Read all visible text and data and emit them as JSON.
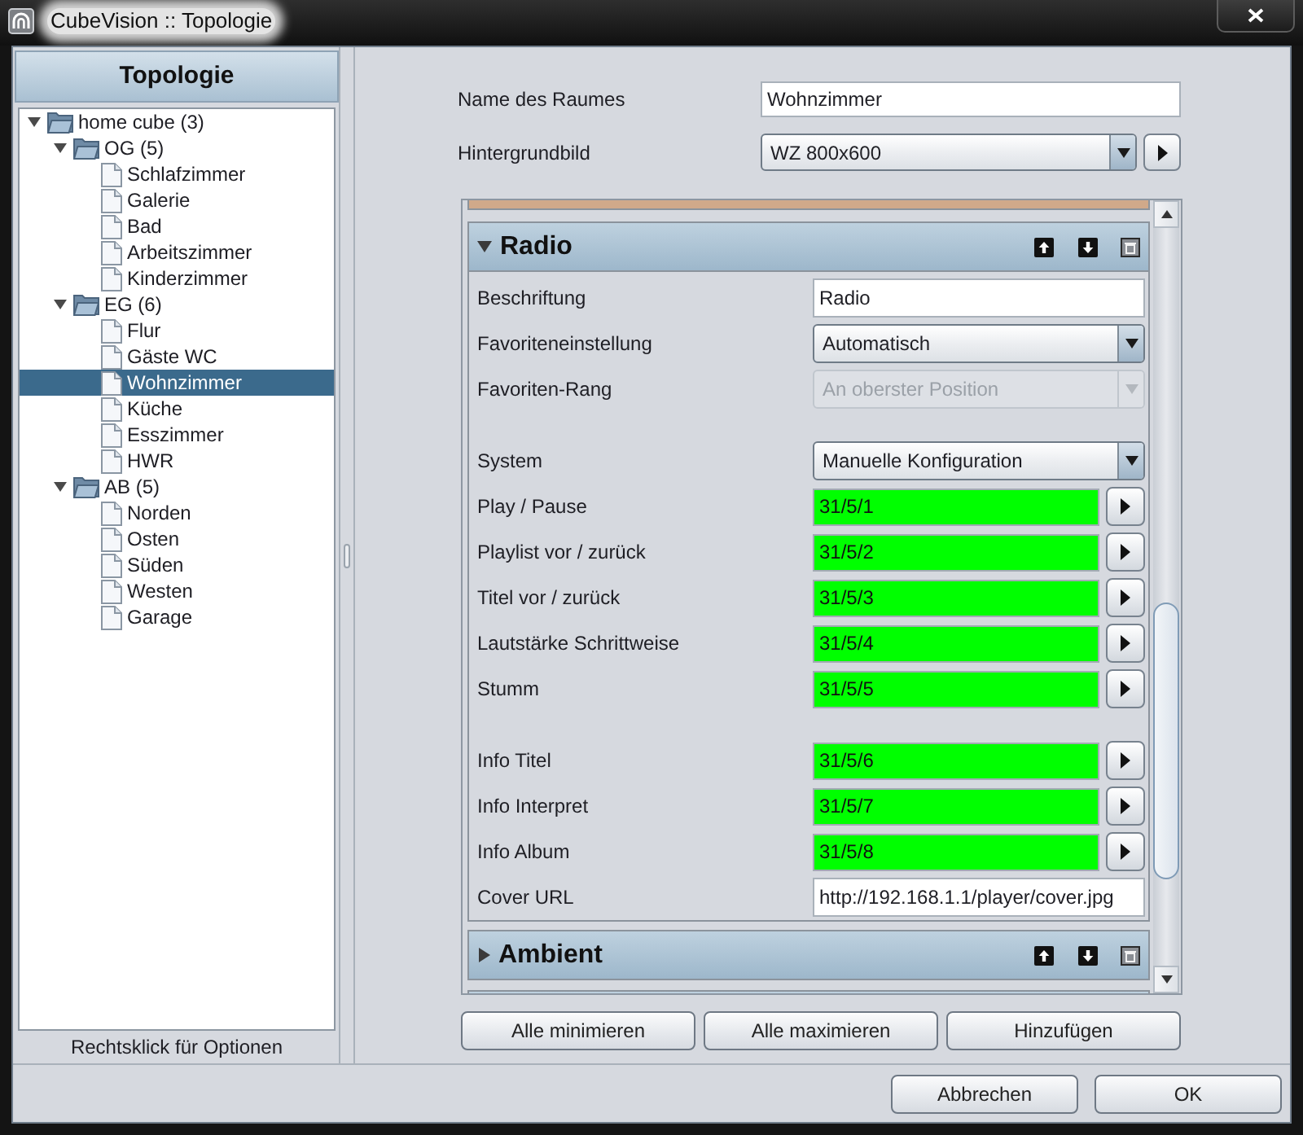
{
  "window": {
    "title": "CubeVision :: Topologie"
  },
  "sidebar": {
    "title": "Topologie",
    "tree": [
      {
        "label": "home cube (3)",
        "expanded": true,
        "selected": false,
        "children": [
          {
            "label": "OG (5)",
            "expanded": true,
            "selected": false,
            "children": [
              {
                "label": "Schlafzimmer",
                "selected": false
              },
              {
                "label": "Galerie",
                "selected": false
              },
              {
                "label": "Bad",
                "selected": false
              },
              {
                "label": "Arbeitszimmer",
                "selected": false
              },
              {
                "label": "Kinderzimmer",
                "selected": false
              }
            ]
          },
          {
            "label": "EG (6)",
            "expanded": true,
            "selected": false,
            "children": [
              {
                "label": "Flur",
                "selected": false
              },
              {
                "label": "Gäste WC",
                "selected": false
              },
              {
                "label": "Wohnzimmer",
                "selected": true
              },
              {
                "label": "Küche",
                "selected": false
              },
              {
                "label": "Esszimmer",
                "selected": false
              },
              {
                "label": "HWR",
                "selected": false
              }
            ]
          },
          {
            "label": "AB (5)",
            "expanded": true,
            "selected": false,
            "children": [
              {
                "label": "Norden",
                "selected": false
              },
              {
                "label": "Osten",
                "selected": false
              },
              {
                "label": "Süden",
                "selected": false
              },
              {
                "label": "Westen",
                "selected": false
              },
              {
                "label": "Garage",
                "selected": false
              }
            ]
          }
        ]
      }
    ],
    "hint": "Rechtsklick für Optionen"
  },
  "room": {
    "fields": [
      {
        "label": "Name des Raumes",
        "kind": "text",
        "value": "Wohnzimmer"
      },
      {
        "label": "Hintergrundbild",
        "kind": "picker",
        "value": "WZ 800x600"
      }
    ]
  },
  "sections": [
    {
      "title": "Radio",
      "expanded": true,
      "groups": [
        [
          {
            "label": "Beschriftung",
            "kind": "text",
            "value": "Radio",
            "disabled": false
          },
          {
            "label": "Favoriteneinstellung",
            "kind": "select",
            "value": "Automatisch",
            "disabled": false
          },
          {
            "label": "Favoriten-Rang",
            "kind": "select",
            "value": "An oberster Position",
            "disabled": true
          }
        ],
        [
          {
            "label": "System",
            "kind": "select",
            "value": "Manuelle Konfiguration",
            "disabled": false
          },
          {
            "label": "Play / Pause",
            "kind": "address",
            "value": "31/5/1",
            "disabled": false
          },
          {
            "label": "Playlist vor / zurück",
            "kind": "address",
            "value": "31/5/2",
            "disabled": false
          },
          {
            "label": "Titel vor / zurück",
            "kind": "address",
            "value": "31/5/3",
            "disabled": false
          },
          {
            "label": "Lautstärke Schrittweise",
            "kind": "address",
            "value": "31/5/4",
            "disabled": false
          },
          {
            "label": "Stumm",
            "kind": "address",
            "value": "31/5/5",
            "disabled": false
          }
        ],
        [
          {
            "label": "Info Titel",
            "kind": "address",
            "value": "31/5/6",
            "disabled": false
          },
          {
            "label": "Info Interpret",
            "kind": "address",
            "value": "31/5/7",
            "disabled": false
          },
          {
            "label": "Info Album",
            "kind": "address",
            "value": "31/5/8",
            "disabled": false
          },
          {
            "label": "Cover URL",
            "kind": "text",
            "value": "http://192.168.1.1/player/cover.jpg",
            "disabled": false
          }
        ]
      ]
    },
    {
      "title": "Ambient",
      "expanded": false
    }
  ],
  "panel_buttons": [
    "Alle minimieren",
    "Alle maximieren",
    "Hinzufügen"
  ],
  "dialog_buttons": [
    "Abbrechen",
    "OK"
  ]
}
